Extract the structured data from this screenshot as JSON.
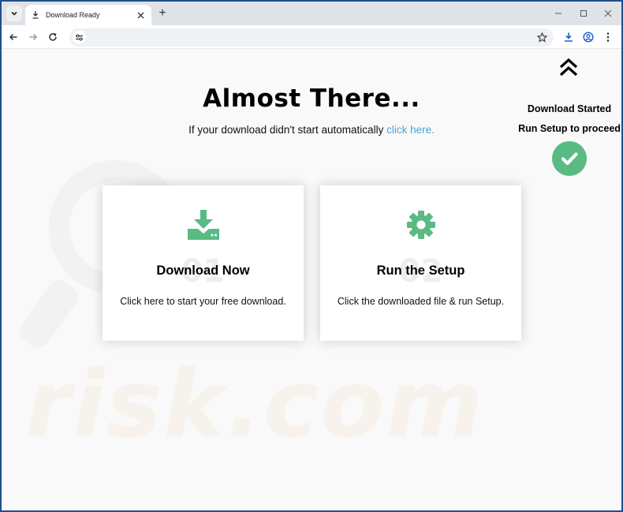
{
  "browser": {
    "tab_title": "Download Ready",
    "new_tab_symbol": "+",
    "icons": {
      "tab_search": "chevron-down-icon",
      "tab_favicon": "download-icon",
      "tab_close": "close-icon",
      "minimize": "minimize-icon",
      "maximize": "maximize-icon",
      "close": "close-icon",
      "back": "back-arrow-icon",
      "forward": "forward-arrow-icon",
      "reload": "reload-icon",
      "site_info": "tune-icon",
      "bookmark": "star-icon",
      "downloads": "download-icon",
      "profile": "profile-icon",
      "menu": "kebab-menu-icon"
    }
  },
  "page": {
    "headline": "Almost There...",
    "subline_text": "If your download didn't start automatically",
    "subline_link": "click here.",
    "side_panel": {
      "status": "Download Started",
      "instruction": "Run Setup to proceed",
      "icon": "check-circle-icon"
    },
    "steps": [
      {
        "number": "01",
        "title": "Download Now",
        "description": "Click here to start your free download.",
        "icon": "download-tray-icon"
      },
      {
        "number": "02",
        "title": "Run the Setup",
        "description": "Click the downloaded file & run Setup.",
        "icon": "gear-icon"
      }
    ],
    "watermark": "risk.com",
    "colors": {
      "accent_green": "#5aba84",
      "link_blue": "#4aa3d6"
    }
  }
}
